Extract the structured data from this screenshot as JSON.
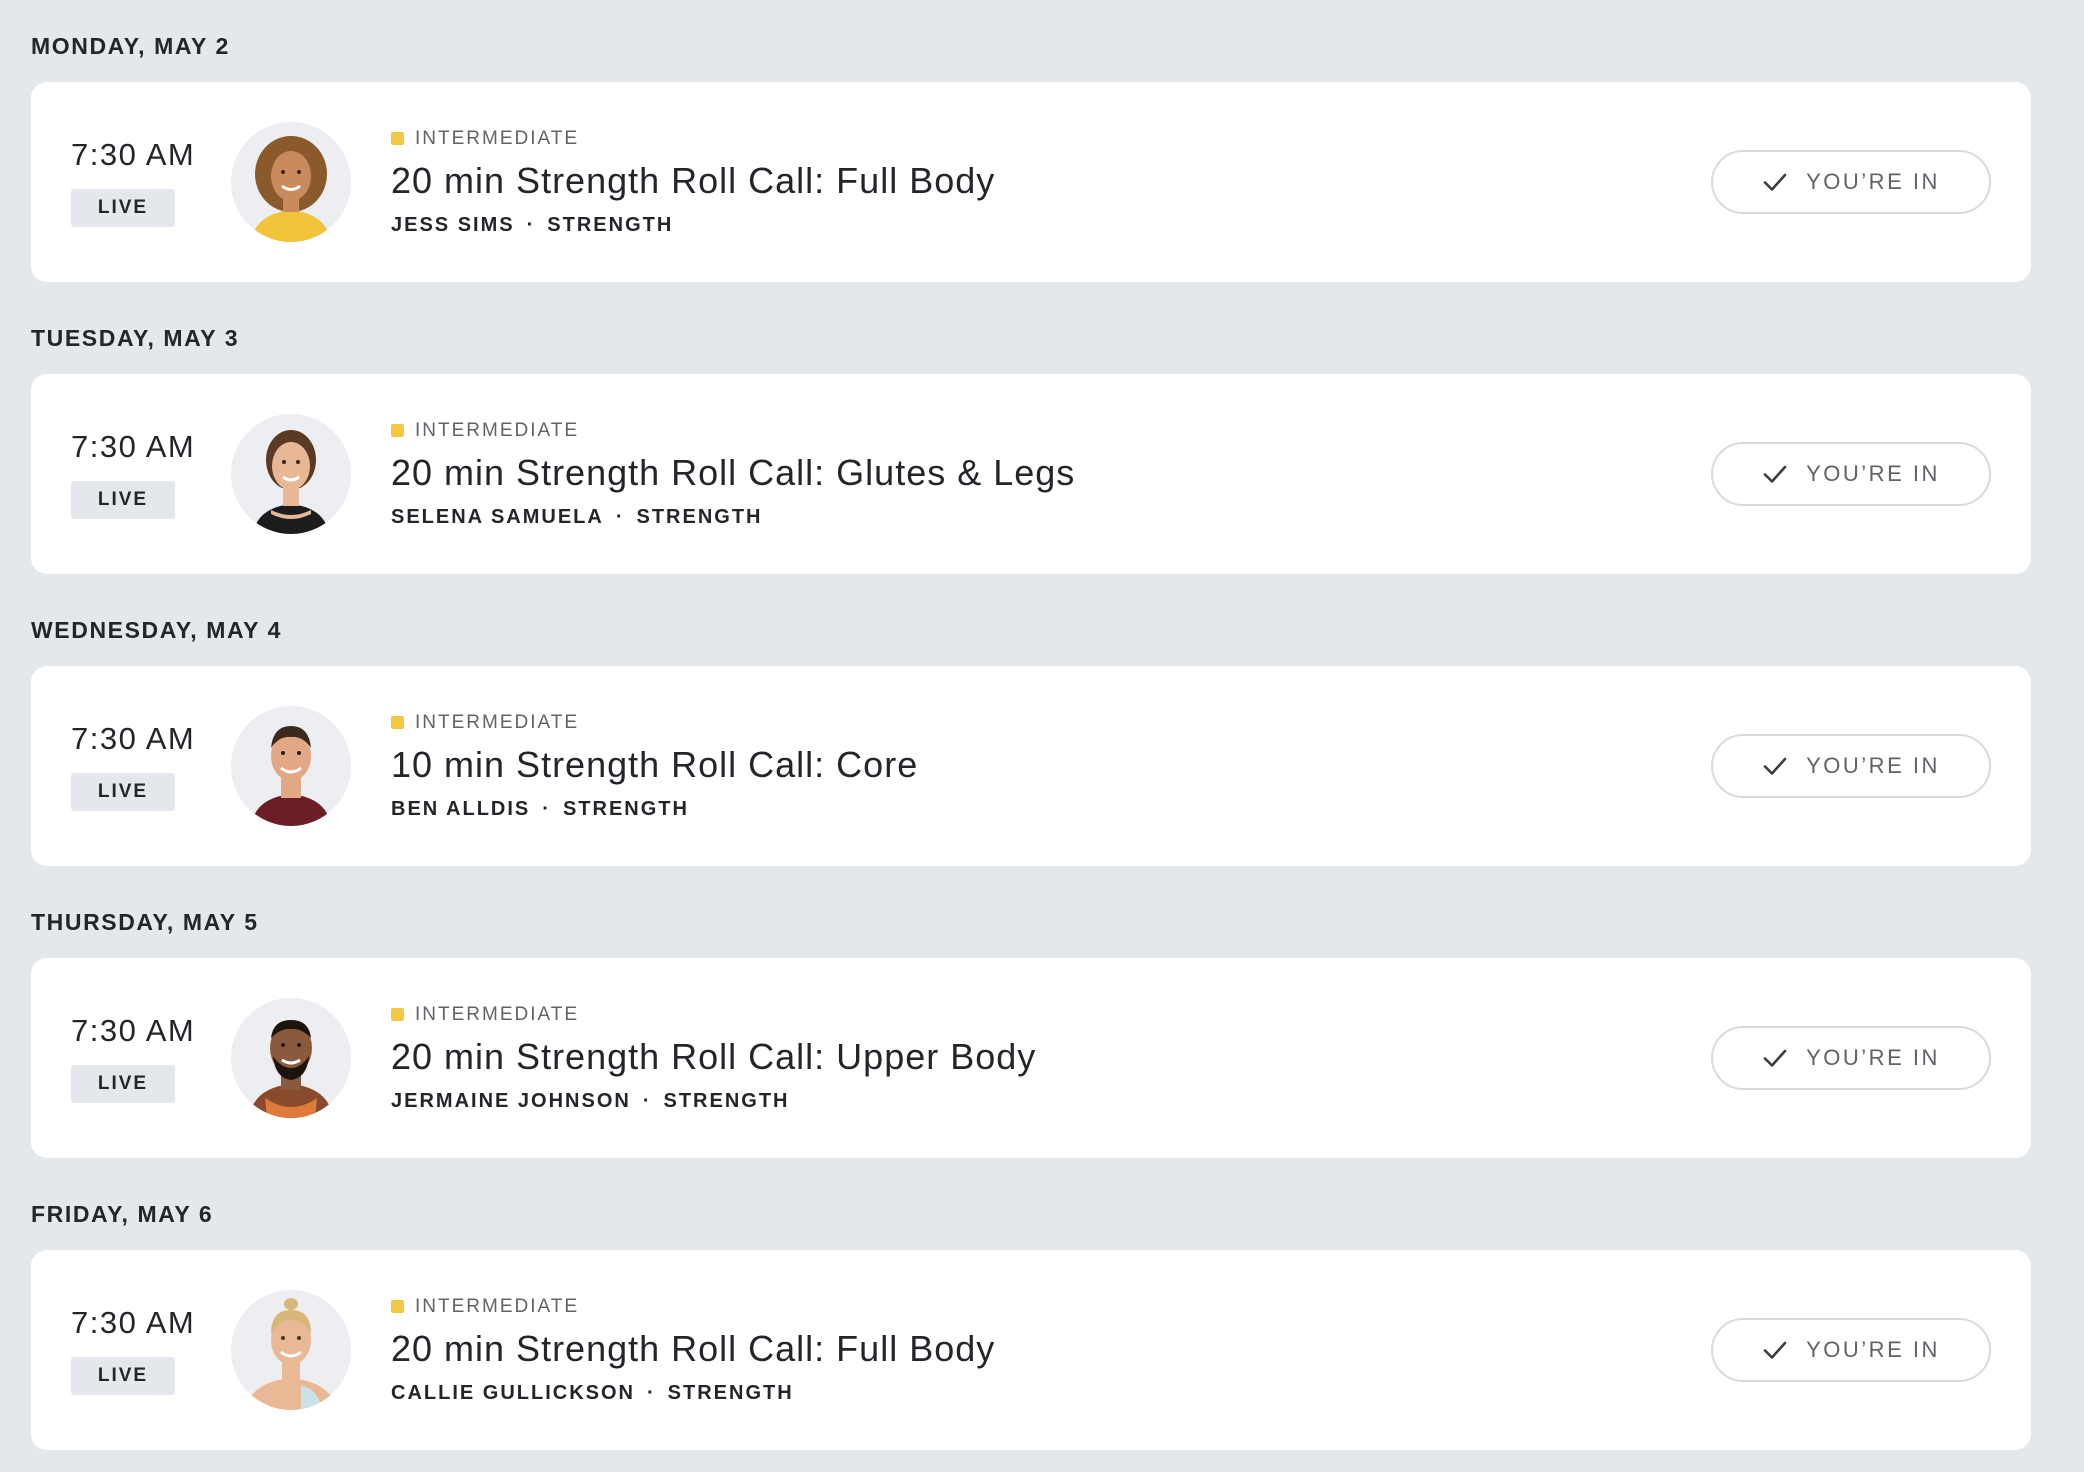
{
  "schedule": [
    {
      "day": "MONDAY, MAY 2",
      "time": "7:30 AM",
      "live_label": "LIVE",
      "difficulty": "INTERMEDIATE",
      "title": "20 min Strength Roll Call: Full Body",
      "instructor": "JESS SIMS",
      "separator": "·",
      "category": "STRENGTH",
      "status": "YOU’RE IN",
      "avatar": "instructor-photo"
    },
    {
      "day": "TUESDAY, MAY 3",
      "time": "7:30 AM",
      "live_label": "LIVE",
      "difficulty": "INTERMEDIATE",
      "title": "20 min Strength Roll Call: Glutes & Legs",
      "instructor": "SELENA SAMUELA",
      "separator": "·",
      "category": "STRENGTH",
      "status": "YOU’RE IN",
      "avatar": "instructor-photo"
    },
    {
      "day": "WEDNESDAY, MAY 4",
      "time": "7:30 AM",
      "live_label": "LIVE",
      "difficulty": "INTERMEDIATE",
      "title": "10 min Strength Roll Call: Core",
      "instructor": "BEN ALLDIS",
      "separator": "·",
      "category": "STRENGTH",
      "status": "YOU’RE IN",
      "avatar": "instructor-photo"
    },
    {
      "day": "THURSDAY, MAY 5",
      "time": "7:30 AM",
      "live_label": "LIVE",
      "difficulty": "INTERMEDIATE",
      "title": "20 min Strength Roll Call: Upper Body",
      "instructor": "JERMAINE JOHNSON",
      "separator": "·",
      "category": "STRENGTH",
      "status": "YOU’RE IN",
      "avatar": "instructor-photo"
    },
    {
      "day": "FRIDAY, MAY 6",
      "time": "7:30 AM",
      "live_label": "LIVE",
      "difficulty": "INTERMEDIATE",
      "title": "20 min Strength Roll Call: Full Body",
      "instructor": "CALLIE GULLICKSON",
      "separator": "·",
      "category": "STRENGTH",
      "status": "YOU’RE IN",
      "avatar": "instructor-photo"
    }
  ],
  "colors": {
    "background": "#e4e7ec",
    "card": "#ffffff",
    "difficulty_intermediate": "#f5c842",
    "text_primary": "#222529",
    "text_secondary": "#5f6368"
  },
  "icons": {
    "status": "check-icon"
  }
}
